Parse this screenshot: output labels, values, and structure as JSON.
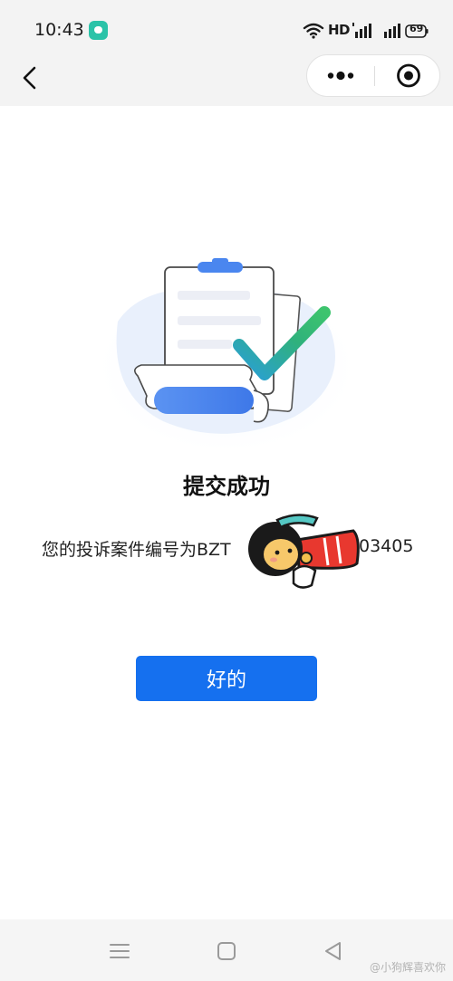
{
  "status_bar": {
    "time": "10:43",
    "network_label": "HD",
    "battery": "69"
  },
  "nav": {
    "back_icon": "chevron-left-icon",
    "more_icon": "more-dots-icon",
    "close_icon": "target-close-icon"
  },
  "result": {
    "title": "提交成功",
    "case_prefix": "您的投诉案件编号为BZT",
    "case_suffix": "03405"
  },
  "actions": {
    "ok_label": "好的"
  },
  "system_nav": {
    "menu_icon": "menu-icon",
    "home_icon": "square-home-icon",
    "back_icon": "triangle-back-icon"
  },
  "watermark": "@小狗辉喜欢你",
  "colors": {
    "primary": "#1570ef",
    "check_green": "#2fb17c",
    "clipboard_blue": "#4a86ef"
  }
}
